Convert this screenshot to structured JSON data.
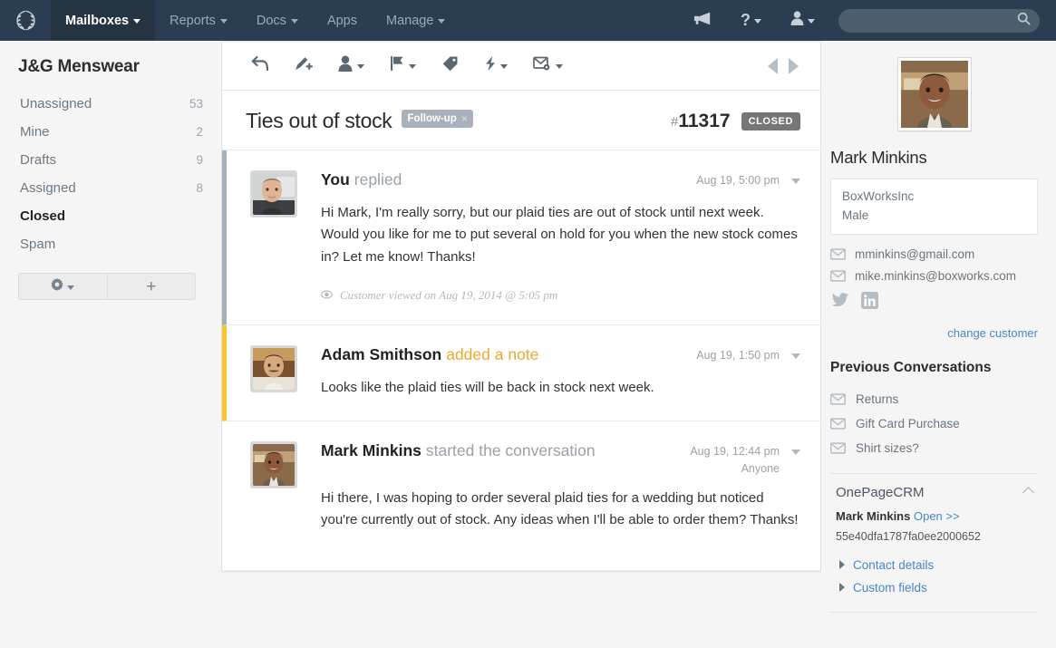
{
  "navbar": {
    "logo_icon": "laurel-wreath-logo",
    "items": [
      {
        "label": "Mailboxes",
        "has_caret": true,
        "active": true
      },
      {
        "label": "Reports",
        "has_caret": true,
        "active": false
      },
      {
        "label": "Docs",
        "has_caret": true,
        "active": false
      },
      {
        "label": "Apps",
        "has_caret": false,
        "active": false
      },
      {
        "label": "Manage",
        "has_caret": true,
        "active": false
      }
    ],
    "announce_icon": "megaphone-icon",
    "help_icon": "question-mark-icon",
    "user_icon": "user-silhouette-icon",
    "search": {
      "value": "",
      "placeholder": "",
      "icon": "search-icon"
    },
    "bg_color": "#2b3e51",
    "active_bg_color": "#243443"
  },
  "sidebar": {
    "title": "J&G Menswear",
    "folders": [
      {
        "label": "Unassigned",
        "count": "53",
        "active": false
      },
      {
        "label": "Mine",
        "count": "2",
        "active": false
      },
      {
        "label": "Drafts",
        "count": "9",
        "active": false
      },
      {
        "label": "Assigned",
        "count": "8",
        "active": false
      },
      {
        "label": "Closed",
        "count": "",
        "active": true
      },
      {
        "label": "Spam",
        "count": "",
        "active": false
      }
    ],
    "settings_button": {
      "icon": "gear-icon",
      "has_caret": true
    },
    "add_button": {
      "icon": "plus-icon"
    }
  },
  "toolbar": {
    "buttons": [
      {
        "icon": "reply-arrow-icon",
        "has_caret": false
      },
      {
        "icon": "pen-add-note-icon",
        "has_caret": false
      },
      {
        "icon": "person-assign-icon",
        "has_caret": true
      },
      {
        "icon": "flag-icon",
        "has_caret": true
      },
      {
        "icon": "tag-icon",
        "has_caret": false
      },
      {
        "icon": "lightning-bolt-icon",
        "has_caret": true
      },
      {
        "icon": "envelope-gear-icon",
        "has_caret": true
      }
    ],
    "prev_icon": "triangle-left-icon",
    "next_icon": "triangle-right-icon"
  },
  "conversation": {
    "subject": "Ties out of stock",
    "tag": {
      "label": "Follow-up",
      "remove": "×",
      "color": "#a9b2bc"
    },
    "hash": "#",
    "ticket_number": "11317",
    "status": "CLOSED",
    "status_color": "#767676"
  },
  "thread": [
    {
      "type": "reply",
      "border_color": "#a6b0bb",
      "author": "You",
      "action": "replied",
      "timestamp": "Aug 19, 5:00 pm",
      "secondary": "",
      "body": "Hi Mark, I'm really sorry, but our plaid ties are out of stock until next week. Would you like for me to put several on hold for you when the new stock comes in? Let me know! Thanks!",
      "footnote": "Customer viewed on Aug 19, 2014 @ 5:05 pm",
      "footnote_icon": "eye-icon",
      "avatar": "avatar-agent-you",
      "caret_icon": "chevron-down-icon"
    },
    {
      "type": "note",
      "border_color": "#fcc52b",
      "author": "Adam Smithson",
      "action": "added a note",
      "timestamp": "Aug 19, 1:50 pm",
      "secondary": "",
      "body": "Looks like the plaid ties will be back in stock next week.",
      "footnote": "",
      "footnote_icon": "",
      "avatar": "avatar-adam-smithson",
      "caret_icon": "chevron-down-icon"
    },
    {
      "type": "customer",
      "border_color": "transparent",
      "author": "Mark Minkins",
      "action": "started the conversation",
      "timestamp": "Aug 19, 12:44 pm",
      "secondary": "Anyone",
      "body": "Hi there, I was hoping to order several plaid ties for a wedding but noticed you're currently out of stock. Any ideas when I'll be able to order them? Thanks!",
      "footnote": "",
      "footnote_icon": "",
      "avatar": "avatar-mark-minkins",
      "caret_icon": "chevron-down-icon"
    }
  ],
  "customer": {
    "photo_icon": "customer-photo",
    "name": "Mark Minkins",
    "company": "BoxWorksInc",
    "gender": "Male",
    "emails": [
      {
        "icon": "envelope-icon",
        "value": "mminkins@gmail.com"
      },
      {
        "icon": "envelope-icon",
        "value": "mike.minkins@boxworks.com"
      }
    ],
    "socials": [
      {
        "icon": "twitter-icon"
      },
      {
        "icon": "linkedin-icon"
      }
    ],
    "change_customer": "change customer"
  },
  "previous_conversations": {
    "title": "Previous Conversations",
    "items": [
      {
        "icon": "envelope-icon",
        "label": "Returns"
      },
      {
        "icon": "envelope-icon",
        "label": "Gift Card Purchase"
      },
      {
        "icon": "envelope-icon",
        "label": "Shirt sizes?"
      }
    ]
  },
  "crm": {
    "title": "OnePageCRM",
    "collapse_icon": "chevron-up-icon",
    "contact_name": "Mark Minkins",
    "open_link": "Open >>",
    "record_id": "55e40dfa1787fa0ee2000652",
    "expanders": [
      {
        "icon": "triangle-right-icon",
        "label": "Contact details"
      },
      {
        "icon": "triangle-right-icon",
        "label": "Custom fields"
      }
    ]
  }
}
